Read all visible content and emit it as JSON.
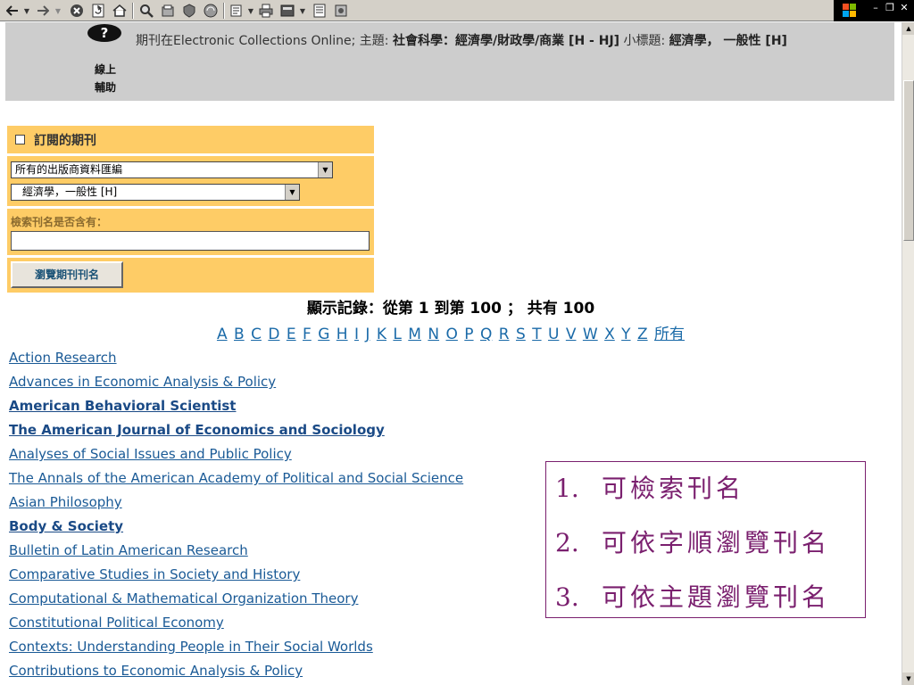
{
  "toolbar": {
    "buttons": [
      "back-icon",
      "forward-icon",
      "stop-icon",
      "refresh-icon",
      "home-icon",
      "search-icon",
      "favorites-icon",
      "history-icon",
      "media-icon",
      "mail-icon",
      "print-icon",
      "edit-icon",
      "discuss-icon",
      "messenger-icon"
    ]
  },
  "header": {
    "help_symbol": "?",
    "help_line1": "線上",
    "help_line2": "輔助",
    "crumb_prefix": "期刊在Electronic Collections Online; 主題: ",
    "crumb_subject": "社會科學：經濟學/財政學/商業 [H - HJ]",
    "crumb_mid": " 小標題: ",
    "crumb_subtitle": "經濟學， 一般性 [H]"
  },
  "form": {
    "subscribed_label": "訂閱的期刊",
    "publisher_select": "所有的出版商資料匯編",
    "subject_select": "經濟學，一般性 [H]",
    "keyword_label": "檢索刊名是否含有：",
    "keyword_value": "",
    "browse_button": "瀏覽期刊刊名"
  },
  "records_text": "顯示記錄：從第 1 到第 100 ； 共有 100",
  "alphabet": [
    "A",
    "B",
    "C",
    "D",
    "E",
    "F",
    "G",
    "H",
    "I",
    "J",
    "K",
    "L",
    "M",
    "N",
    "O",
    "P",
    "Q",
    "R",
    "S",
    "T",
    "U",
    "V",
    "W",
    "X",
    "Y",
    "Z",
    "所有"
  ],
  "journals": [
    {
      "title": "Action Research",
      "bold": false
    },
    {
      "title": "Advances in Economic Analysis & Policy",
      "bold": false
    },
    {
      "title": "American Behavioral Scientist",
      "bold": true
    },
    {
      "title": "The American Journal of Economics and Sociology",
      "bold": true
    },
    {
      "title": "Analyses of Social Issues and Public Policy",
      "bold": false
    },
    {
      "title": "The Annals of the American Academy of Political and Social Science",
      "bold": false
    },
    {
      "title": "Asian Philosophy",
      "bold": false
    },
    {
      "title": "Body & Society",
      "bold": true
    },
    {
      "title": "Bulletin of Latin American Research",
      "bold": false
    },
    {
      "title": "Comparative Studies in Society and History",
      "bold": false
    },
    {
      "title": "Computational & Mathematical Organization Theory",
      "bold": false
    },
    {
      "title": "Constitutional Political Economy",
      "bold": false
    },
    {
      "title": "Contexts: Understanding People in Their Social Worlds",
      "bold": false
    },
    {
      "title": "Contributions to Economic Analysis & Policy",
      "bold": false
    }
  ],
  "overlay": {
    "notes": [
      {
        "num": "1.",
        "text": "可檢索刊名"
      },
      {
        "num": "2.",
        "text": "可依字順瀏覽刊名"
      },
      {
        "num": "3.",
        "text": "可依主題瀏覽刊名"
      }
    ]
  },
  "colors": {
    "form_bg": "#fecc66",
    "header_bg": "#cdcdcd",
    "link": "#1a5a96",
    "overlay_accent": "#7a1f6e"
  }
}
